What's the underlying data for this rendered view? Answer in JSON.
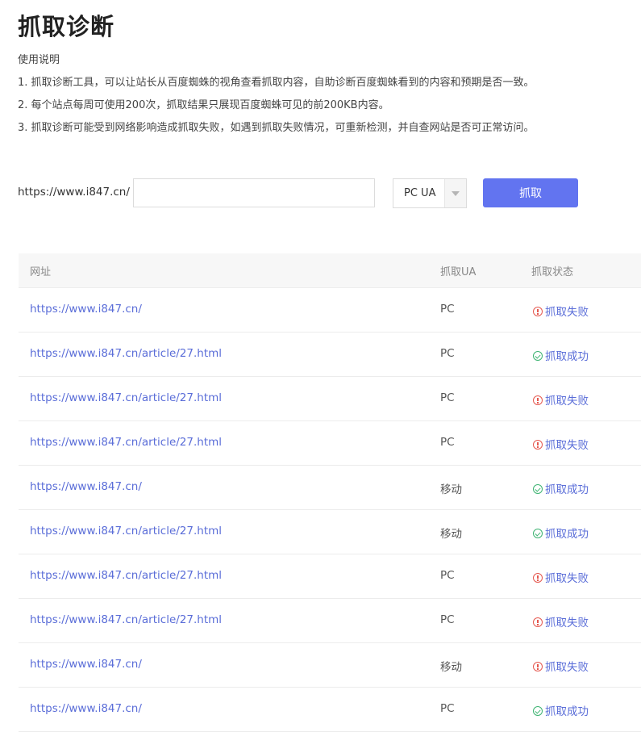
{
  "title": "抓取诊断",
  "instructions": {
    "heading": "使用说明",
    "items": [
      "1. 抓取诊断工具，可以让站长从百度蜘蛛的视角查看抓取内容，自助诊断百度蜘蛛看到的内容和预期是否一致。",
      "2. 每个站点每周可使用200次，抓取结果只展现百度蜘蛛可见的前200KB内容。",
      "3. 抓取诊断可能受到网络影响造成抓取失败，如遇到抓取失败情况，可重新检测，并自查网站是否可正常访问。"
    ]
  },
  "form": {
    "url_prefix": "https://www.i847.cn/",
    "url_value": "",
    "ua_selected": "PC UA",
    "submit_label": "抓取"
  },
  "table": {
    "headers": {
      "url": "网址",
      "ua": "抓取UA",
      "status": "抓取状态"
    },
    "rows": [
      {
        "url": "https://www.i847.cn/",
        "ua": "PC",
        "status": "抓取失败",
        "status_type": "fail"
      },
      {
        "url": "https://www.i847.cn/article/27.html",
        "ua": "PC",
        "status": "抓取成功",
        "status_type": "success"
      },
      {
        "url": "https://www.i847.cn/article/27.html",
        "ua": "PC",
        "status": "抓取失败",
        "status_type": "fail"
      },
      {
        "url": "https://www.i847.cn/article/27.html",
        "ua": "PC",
        "status": "抓取失败",
        "status_type": "fail"
      },
      {
        "url": "https://www.i847.cn/",
        "ua": "移动",
        "status": "抓取成功",
        "status_type": "success"
      },
      {
        "url": "https://www.i847.cn/article/27.html",
        "ua": "移动",
        "status": "抓取成功",
        "status_type": "success"
      },
      {
        "url": "https://www.i847.cn/article/27.html",
        "ua": "PC",
        "status": "抓取失败",
        "status_type": "fail"
      },
      {
        "url": "https://www.i847.cn/article/27.html",
        "ua": "PC",
        "status": "抓取失败",
        "status_type": "fail"
      },
      {
        "url": "https://www.i847.cn/",
        "ua": "移动",
        "status": "抓取失败",
        "status_type": "fail"
      },
      {
        "url": "https://www.i847.cn/",
        "ua": "PC",
        "status": "抓取成功",
        "status_type": "success"
      }
    ]
  },
  "colors": {
    "accent": "#6274f0",
    "link": "#5a6dd8",
    "fail": "#e5584f",
    "success": "#3cb371"
  },
  "icons": {
    "fail": "exclamation-circle-icon",
    "success": "check-circle-icon",
    "select": "caret-down-icon"
  }
}
